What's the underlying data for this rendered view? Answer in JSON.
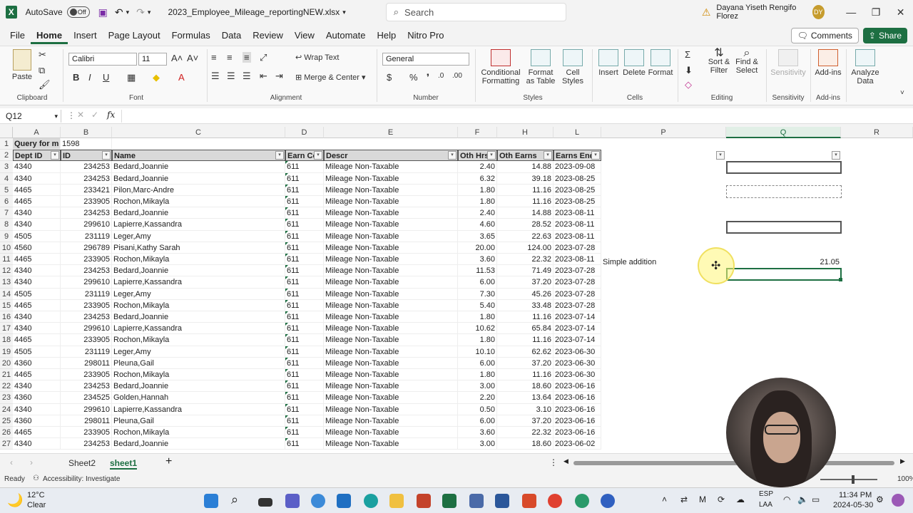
{
  "window": {
    "autosave_label": "AutoSave",
    "autosave_state": "Off",
    "filename": "2023_Employee_Mileage_reportingNEW.xlsx",
    "search_placeholder": "Search",
    "user_name": "Dayana Yiseth Rengifo Florez",
    "user_initials": "DY"
  },
  "menu": {
    "tabs": [
      "File",
      "Home",
      "Insert",
      "Page Layout",
      "Formulas",
      "Data",
      "Review",
      "View",
      "Automate",
      "Help",
      "Nitro Pro"
    ],
    "active_tab": "Home",
    "comments_label": "Comments",
    "share_label": "Share"
  },
  "ribbon": {
    "clipboard": {
      "label": "Clipboard",
      "paste": "Paste"
    },
    "font": {
      "label": "Font",
      "family": "Calibri",
      "size": "11"
    },
    "alignment": {
      "label": "Alignment",
      "wrap": "Wrap Text",
      "merge": "Merge & Center"
    },
    "number": {
      "label": "Number",
      "format": "General"
    },
    "styles": {
      "label": "Styles",
      "cond": "Conditional Formatting",
      "table": "Format as Table",
      "cell": "Cell Styles"
    },
    "cells": {
      "label": "Cells",
      "insert": "Insert",
      "delete": "Delete",
      "format": "Format"
    },
    "editing": {
      "label": "Editing",
      "sort": "Sort & Filter",
      "find": "Find & Select"
    },
    "sensitivity": {
      "label": "Sensitivity",
      "btn": "Sensitivity"
    },
    "addins": {
      "label": "Add-ins",
      "btn": "Add-ins",
      "analyze": "Analyze Data"
    }
  },
  "formula_bar": {
    "name_box": "Q12",
    "fx": "fx",
    "content": ""
  },
  "columns": [
    "A",
    "B",
    "C",
    "D",
    "E",
    "F",
    "H",
    "L",
    "P",
    "Q",
    "R"
  ],
  "sheet": {
    "row1": {
      "a": "Query for m",
      "b": "1598"
    },
    "headers": [
      "Dept ID",
      "ID",
      "Name",
      "Earn Co",
      "Descr",
      "Oth Hrs",
      "Oth Earns",
      "Earns End"
    ],
    "rows": [
      [
        "4340",
        "234253",
        "Bedard,Joannie",
        "611",
        "Mileage Non-Taxable",
        "2.40",
        "14.88",
        "2023-09-08"
      ],
      [
        "4340",
        "234253",
        "Bedard,Joannie",
        "611",
        "Mileage Non-Taxable",
        "6.32",
        "39.18",
        "2023-08-25"
      ],
      [
        "4465",
        "233421",
        "Pilon,Marc-Andre",
        "611",
        "Mileage Non-Taxable",
        "1.80",
        "11.16",
        "2023-08-25"
      ],
      [
        "4465",
        "233905",
        "Rochon,Mikayla",
        "611",
        "Mileage Non-Taxable",
        "1.80",
        "11.16",
        "2023-08-25"
      ],
      [
        "4340",
        "234253",
        "Bedard,Joannie",
        "611",
        "Mileage Non-Taxable",
        "2.40",
        "14.88",
        "2023-08-11"
      ],
      [
        "4340",
        "299610",
        "Lapierre,Kassandra",
        "611",
        "Mileage Non-Taxable",
        "4.60",
        "28.52",
        "2023-08-11"
      ],
      [
        "4505",
        "231119",
        "Leger,Amy",
        "611",
        "Mileage Non-Taxable",
        "3.65",
        "22.63",
        "2023-08-11"
      ],
      [
        "4560",
        "296789",
        "Pisani,Kathy Sarah",
        "611",
        "Mileage Non-Taxable",
        "20.00",
        "124.00",
        "2023-07-28"
      ],
      [
        "4465",
        "233905",
        "Rochon,Mikayla",
        "611",
        "Mileage Non-Taxable",
        "3.60",
        "22.32",
        "2023-08-11"
      ],
      [
        "4340",
        "234253",
        "Bedard,Joannie",
        "611",
        "Mileage Non-Taxable",
        "11.53",
        "71.49",
        "2023-07-28"
      ],
      [
        "4340",
        "299610",
        "Lapierre,Kassandra",
        "611",
        "Mileage Non-Taxable",
        "6.00",
        "37.20",
        "2023-07-28"
      ],
      [
        "4505",
        "231119",
        "Leger,Amy",
        "611",
        "Mileage Non-Taxable",
        "7.30",
        "45.26",
        "2023-07-28"
      ],
      [
        "4465",
        "233905",
        "Rochon,Mikayla",
        "611",
        "Mileage Non-Taxable",
        "5.40",
        "33.48",
        "2023-07-28"
      ],
      [
        "4340",
        "234253",
        "Bedard,Joannie",
        "611",
        "Mileage Non-Taxable",
        "1.80",
        "11.16",
        "2023-07-14"
      ],
      [
        "4340",
        "299610",
        "Lapierre,Kassandra",
        "611",
        "Mileage Non-Taxable",
        "10.62",
        "65.84",
        "2023-07-14"
      ],
      [
        "4465",
        "233905",
        "Rochon,Mikayla",
        "611",
        "Mileage Non-Taxable",
        "1.80",
        "11.16",
        "2023-07-14"
      ],
      [
        "4505",
        "231119",
        "Leger,Amy",
        "611",
        "Mileage Non-Taxable",
        "10.10",
        "62.62",
        "2023-06-30"
      ],
      [
        "4360",
        "298011",
        "Pleuna,Gail",
        "611",
        "Mileage Non-Taxable",
        "6.00",
        "37.20",
        "2023-06-30"
      ],
      [
        "4465",
        "233905",
        "Rochon,Mikayla",
        "611",
        "Mileage Non-Taxable",
        "1.80",
        "11.16",
        "2023-06-30"
      ],
      [
        "4340",
        "234253",
        "Bedard,Joannie",
        "611",
        "Mileage Non-Taxable",
        "3.00",
        "18.60",
        "2023-06-16"
      ],
      [
        "4360",
        "234525",
        "Golden,Hannah",
        "611",
        "Mileage Non-Taxable",
        "2.20",
        "13.64",
        "2023-06-16"
      ],
      [
        "4340",
        "299610",
        "Lapierre,Kassandra",
        "611",
        "Mileage Non-Taxable",
        "0.50",
        "3.10",
        "2023-06-16"
      ],
      [
        "4360",
        "298011",
        "Pleuna,Gail",
        "611",
        "Mileage Non-Taxable",
        "6.00",
        "37.20",
        "2023-06-16"
      ],
      [
        "4465",
        "233905",
        "Rochon,Mikayla",
        "611",
        "Mileage Non-Taxable",
        "3.60",
        "22.32",
        "2023-06-16"
      ],
      [
        "4340",
        "234253",
        "Bedard,Joannie",
        "611",
        "Mileage Non-Taxable",
        "3.00",
        "18.60",
        "2023-06-02"
      ]
    ],
    "note_label": "Simple addition",
    "note_value": "21.05"
  },
  "sheets": {
    "tabs": [
      "Sheet2",
      "sheet1"
    ],
    "active": "sheet1"
  },
  "status": {
    "ready": "Ready",
    "accessibility": "Accessibility: Investigate",
    "zoom": "100%"
  },
  "taskbar": {
    "temp": "12°C",
    "weather": "Clear",
    "lang1": "ESP",
    "lang2": "LAA",
    "time": "11:34 PM",
    "date": "2024-05-30"
  }
}
